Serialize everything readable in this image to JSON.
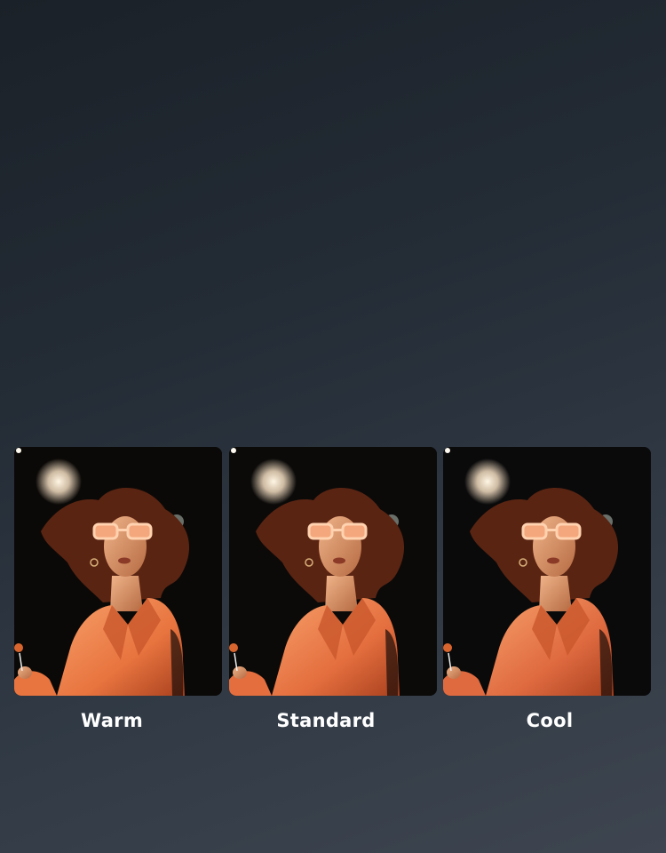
{
  "comparison": {
    "options": [
      {
        "id": "warm",
        "label": "Warm",
        "tint": "#e8743f",
        "bg": "#0b0907"
      },
      {
        "id": "standard",
        "label": "Standard",
        "tint": "#e46e3e",
        "bg": "#0b0a09"
      },
      {
        "id": "cool",
        "label": "Cool",
        "tint": "#df6a40",
        "bg": "#0a0a0b"
      }
    ]
  }
}
